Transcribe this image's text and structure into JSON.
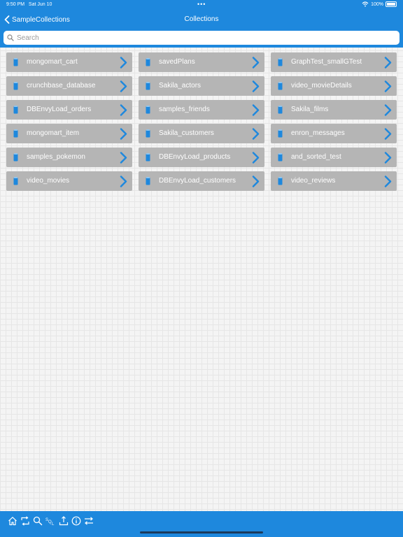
{
  "status_bar": {
    "time": "9:50 PM",
    "date": "Sat Jun 10",
    "battery": "100%"
  },
  "nav": {
    "back_label": "SampleCollections",
    "title": "Collections"
  },
  "search": {
    "placeholder": "Search"
  },
  "collections": [
    "mongomart_cart",
    "savedPlans",
    "GraphTest_smallGTest",
    "crunchbase_database",
    "Sakila_actors",
    "video_movieDetails",
    "DBEnvyLoad_orders",
    "samples_friends",
    "Sakila_films",
    "mongomart_item",
    "Sakila_customers",
    "enron_messages",
    "samples_pokemon",
    "DBEnvyLoad_products",
    "and_sorted_test",
    "video_movies",
    "DBEnvyLoad_customers",
    "video_reviews"
  ],
  "toolbar": {
    "icons": [
      "home-icon",
      "refresh-icon",
      "search-icon",
      "sql-icon",
      "export-icon",
      "info-icon",
      "transfer-icon"
    ],
    "sql_label": "SQL"
  },
  "colors": {
    "accent": "#1e88dd",
    "item_bg": "#b5b5b5",
    "chevron": "#1e88dd"
  }
}
